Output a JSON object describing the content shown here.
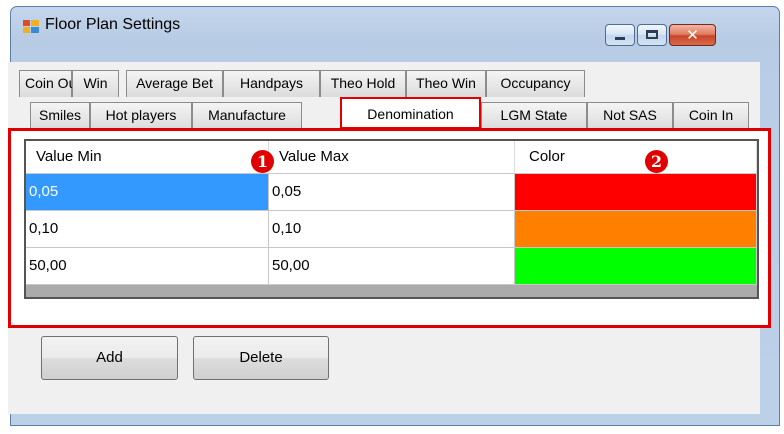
{
  "window": {
    "title": "Floor Plan Settings"
  },
  "tabs": {
    "row1": [
      "Coin Out",
      "Win",
      "Average Bet",
      "Handpays",
      "Theo Hold",
      "Theo Win",
      "Occupancy"
    ],
    "row2": [
      "Smiles",
      "Hot players",
      "Manufacture",
      "Denomination",
      "LGM State",
      "Not SAS",
      "Coin In"
    ],
    "selected": "Denomination"
  },
  "grid": {
    "columns": [
      "Value Min",
      "Value Max",
      "Color"
    ],
    "rows": [
      {
        "min": "0,05",
        "max": "0,05",
        "color": "#ff0000"
      },
      {
        "min": "0,10",
        "max": "0,10",
        "color": "#ff8000"
      },
      {
        "min": "50,00",
        "max": "50,00",
        "color": "#00ff00"
      }
    ]
  },
  "markers": {
    "one": "1",
    "two": "2"
  },
  "buttons": {
    "add_label": "Add",
    "delete_label": "Delete"
  },
  "colors": {
    "highlight": "#e00000",
    "selection": "#3399ff"
  }
}
